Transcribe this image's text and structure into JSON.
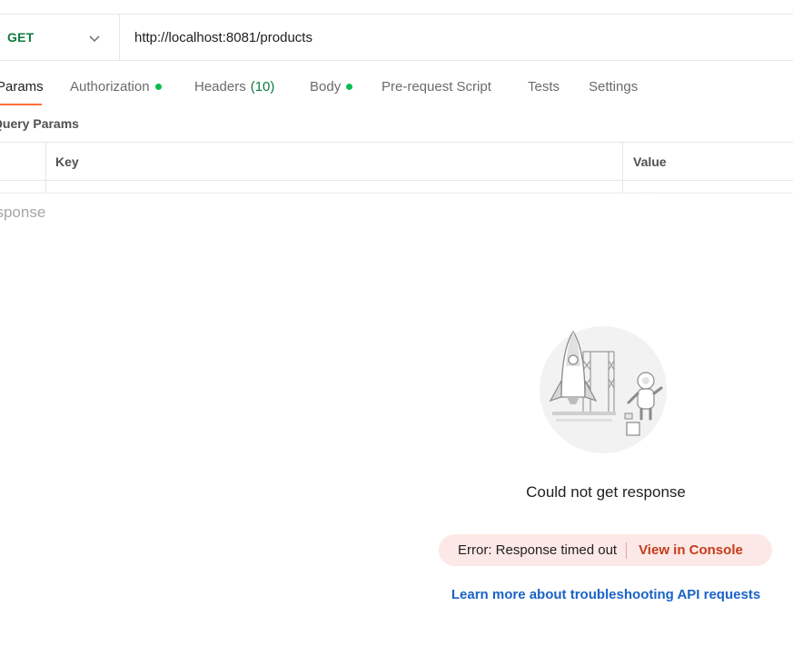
{
  "request": {
    "method": "GET",
    "url": "http://localhost:8081/products"
  },
  "tabs": [
    {
      "label": "Params",
      "active": true
    },
    {
      "label": "Authorization",
      "dot": true
    },
    {
      "label": "Headers",
      "count": "(10)"
    },
    {
      "label": "Body",
      "dot": true
    },
    {
      "label": "Pre-request Script"
    },
    {
      "label": "Tests"
    },
    {
      "label": "Settings"
    }
  ],
  "params": {
    "title": "Query Params",
    "col_key": "Key",
    "col_value": "Value"
  },
  "response": {
    "label": "esponse",
    "message": "Could not get response",
    "error_text": "Error: Response timed out",
    "error_link": "View in Console",
    "learn_more": "Learn more about troubleshooting API requests"
  },
  "colors": {
    "method_get": "#0f7b3f",
    "active_tab_underline": "#ff6c37",
    "status_dot": "#0cbb52",
    "error_bg": "#fce8e6",
    "error_link": "#c43c1b",
    "link": "#1a63c8"
  }
}
